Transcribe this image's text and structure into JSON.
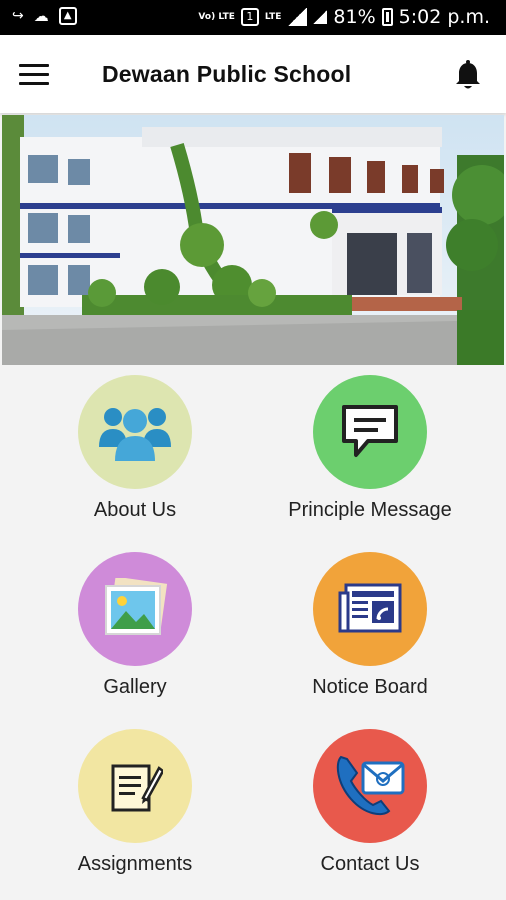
{
  "status_bar": {
    "left_icons": [
      "call-forward-icon",
      "cloud-icon",
      "image-icon"
    ],
    "volte_label": "Vo) LTE",
    "sim_label": "1",
    "lte_label": "LTE",
    "battery_percent": "81%",
    "time": "5:02 p.m."
  },
  "appbar": {
    "title": "Dewaan Public School",
    "menu_icon": "hamburger-menu-icon",
    "notification_icon": "bell-icon"
  },
  "hero": {
    "description_icon": "school-building-photo"
  },
  "menu_tiles": [
    {
      "label": "About Us",
      "icon": "people-group-icon",
      "color": "#dde5b0"
    },
    {
      "label": "Principle Message",
      "icon": "chat-message-icon",
      "color": "#6ccf6e"
    },
    {
      "label": "Gallery",
      "icon": "picture-gallery-icon",
      "color": "#cf8bd9"
    },
    {
      "label": "Notice Board",
      "icon": "newspaper-icon",
      "color": "#f1a33a"
    },
    {
      "label": "Assignments",
      "icon": "notepad-pen-icon",
      "color": "#f2e6a2"
    },
    {
      "label": "Contact Us",
      "icon": "phone-mail-icon",
      "color": "#e8594c"
    }
  ]
}
